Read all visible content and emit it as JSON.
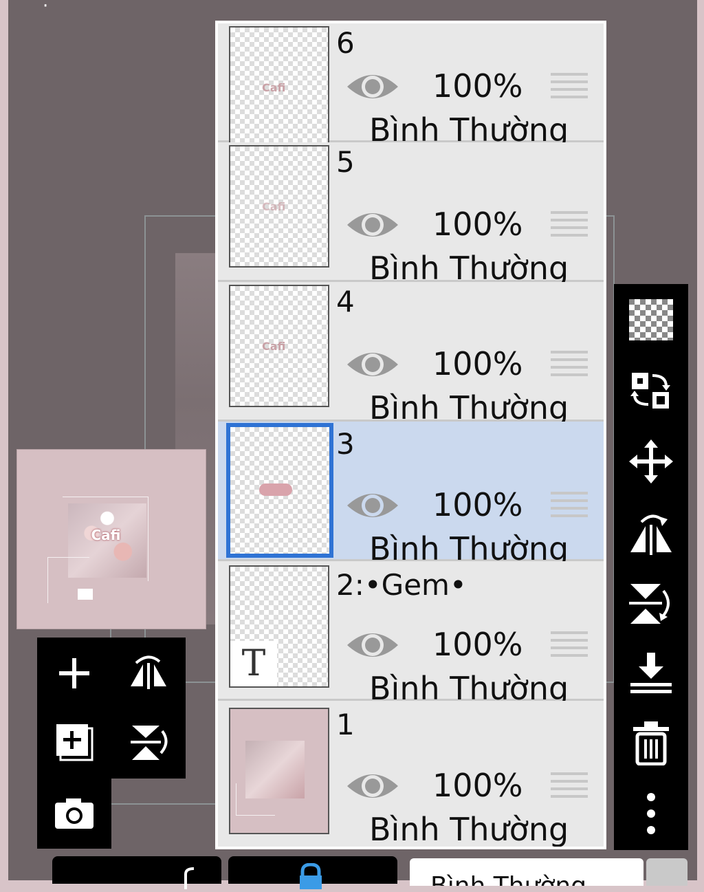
{
  "layers": [
    {
      "number": "6",
      "opacity": "100%",
      "blend": "Bình Thường",
      "thumb_text": "Cafi",
      "selected": false
    },
    {
      "number": "5",
      "opacity": "100%",
      "blend": "Bình Thường",
      "thumb_text": "Cafi",
      "selected": false
    },
    {
      "number": "4",
      "opacity": "100%",
      "blend": "Bình Thường",
      "thumb_text": "Cafi",
      "selected": false
    },
    {
      "number": "3",
      "opacity": "100%",
      "blend": "Bình Thường",
      "selected": true
    },
    {
      "number": "2:•Gem•",
      "opacity": "100%",
      "blend": "Bình Thường",
      "thumb_text": "T",
      "selected": false
    },
    {
      "number": "1",
      "opacity": "100%",
      "blend": "Bình Thường",
      "selected": false
    }
  ],
  "preview": {
    "caption": "Cafi"
  },
  "bottom_bar": {
    "blend_mode_label": "Bình Thường"
  },
  "colors": {
    "selected_row": "#cbd9ee",
    "selected_border": "#2f73d4",
    "panel_bg": "#e8e8e8"
  },
  "icons": {
    "right_toolbar": [
      "transparency-checker-icon",
      "swap-layers-icon",
      "move-icon",
      "flip-horizontal-icon",
      "flip-vertical-icon",
      "merge-down-icon",
      "trash-icon",
      "more-vertical-icon"
    ],
    "mini_toolbar": [
      "add-layer-icon",
      "flip-horizontal-icon",
      "add-layer-copy-icon",
      "flip-vertical-icon",
      "camera-icon"
    ]
  }
}
